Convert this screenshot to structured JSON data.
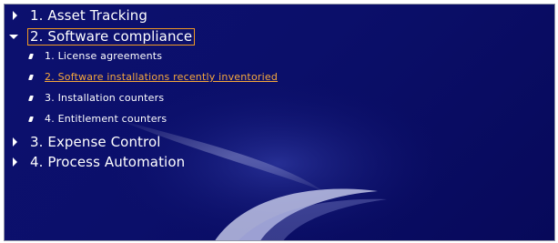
{
  "menu": {
    "items": [
      {
        "label": "1. Asset Tracking"
      },
      {
        "label": "2. Software compliance",
        "children": [
          {
            "label": "1. License agreements"
          },
          {
            "label": "2. Software installations recently inventoried"
          },
          {
            "label": "3. Installation counters"
          },
          {
            "label": "4. Entitlement counters"
          }
        ]
      },
      {
        "label": "3. Expense Control"
      },
      {
        "label": "4. Process Automation"
      }
    ]
  },
  "colors": {
    "background": "#0b0f6a",
    "highlight_border": "#f29a22",
    "active_link": "#f6a83c",
    "text": "#ffffff"
  },
  "icons": {
    "collapsed": "triangle-right-icon",
    "expanded": "triangle-down-icon",
    "sub_item": "bullet-icon"
  }
}
